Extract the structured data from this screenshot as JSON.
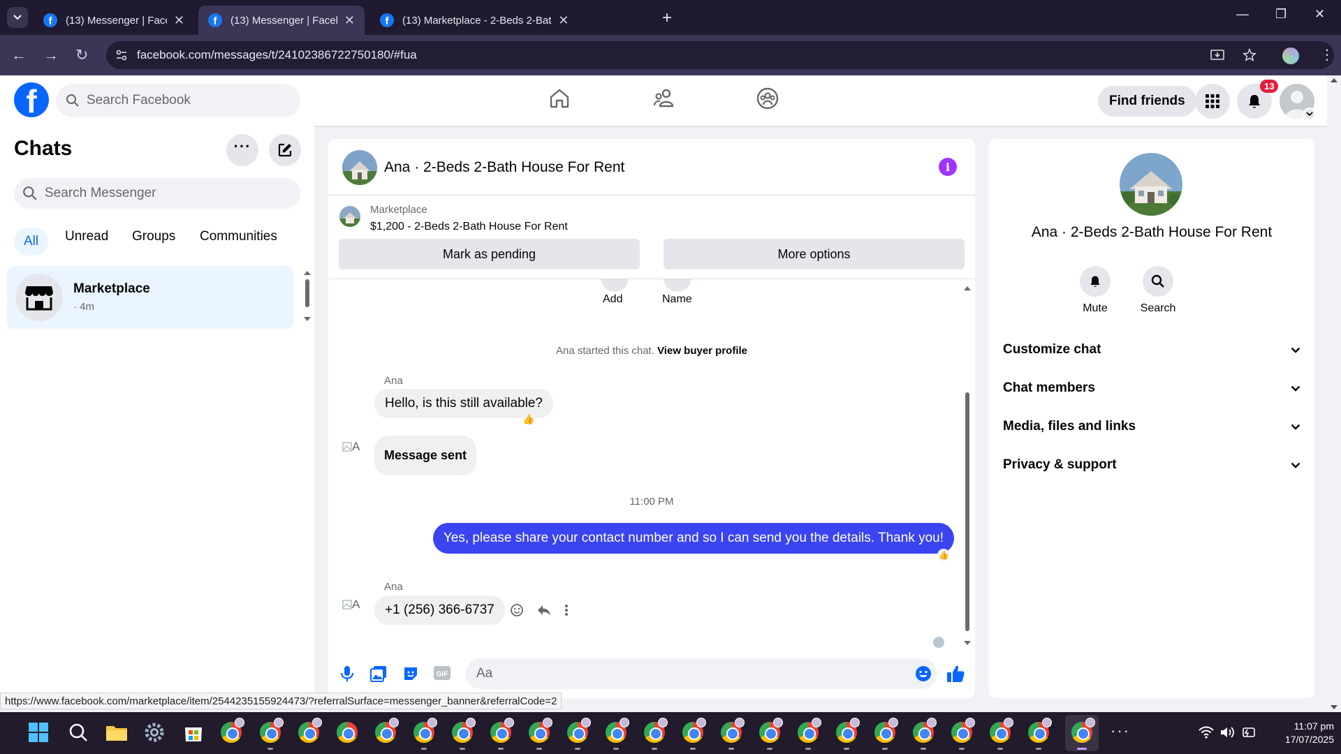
{
  "browser": {
    "tabs": [
      {
        "title": "(13) Messenger | Facebook",
        "active": false
      },
      {
        "title": "(13) Messenger | Facebook",
        "active": true
      },
      {
        "title": "(13) Marketplace - 2-Beds 2-Bat",
        "active": false
      }
    ],
    "url": "facebook.com/messages/t/24102386722750180/#fua",
    "status_url": "https://www.facebook.com/marketplace/item/2544235155924473/?referralSurface=messenger_banner&referralCode=2"
  },
  "fb_header": {
    "logo": "f",
    "search_placeholder": "Search Facebook",
    "find_friends": "Find friends",
    "notification_count": "13"
  },
  "sidebar": {
    "title": "Chats",
    "search_placeholder": "Search Messenger",
    "filters": [
      "All",
      "Unread",
      "Groups",
      "Communities"
    ],
    "active_filter": "All",
    "chats": [
      {
        "name": "Marketplace",
        "meta": "· 4m"
      }
    ]
  },
  "conversation": {
    "title": "Ana · 2-Beds 2-Bath House For Rent",
    "listing": {
      "label": "Marketplace",
      "item": "$1,200 - 2-Beds 2-Bath House For Rent"
    },
    "actions": {
      "pending": "Mark as pending",
      "more": "More options"
    },
    "top_actions": {
      "add": "Add",
      "name": "Name"
    },
    "system": {
      "prefix": "Ana started this chat.",
      "link": "View buyer profile"
    },
    "messages": [
      {
        "sender": "Ana",
        "text": "Hello, is this still available?",
        "reaction": "👍"
      },
      {
        "alt": "A",
        "text": "Message sent"
      },
      {
        "timestamp": "11:00 PM"
      },
      {
        "sender": "me",
        "text": "Yes, please share your contact number and so I can send you the details. Thank you!"
      },
      {
        "sender": "Ana",
        "alt": "A",
        "text": "+1 (256) 366-6737"
      }
    ],
    "composer_placeholder": "Aa"
  },
  "info_panel": {
    "name": "Ana · 2-Beds 2-Bath House For Rent",
    "actions": {
      "mute": "Mute",
      "search": "Search"
    },
    "sections": [
      "Customize chat",
      "Chat members",
      "Media, files and links",
      "Privacy & support"
    ]
  },
  "taskbar": {
    "time": "11:07 pm",
    "date": "17/07/2025"
  },
  "colors": {
    "fb_blue": "#0866ff",
    "outgoing_bubble": "#3a44f0",
    "info_purple": "#a033ff",
    "notif_red": "#e41e3f"
  }
}
